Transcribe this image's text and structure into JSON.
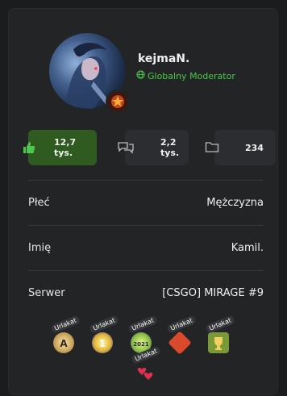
{
  "profile": {
    "username": "kejmaN.",
    "role": "Globalny Moderator",
    "role_color": "#4ac94a"
  },
  "stats": {
    "likes": "12,7 tys.",
    "messages": "2,2 tys.",
    "files": "234"
  },
  "details": [
    {
      "label": "Płeć",
      "value": "Mężczyzna"
    },
    {
      "label": "Imię",
      "value": "Kamil."
    },
    {
      "label": "Serwer",
      "value": "[CSGO] MIRAGE #9"
    }
  ],
  "awards": {
    "tag": "Urlakat",
    "icons": [
      "award-a-icon",
      "award-coin-icon",
      "award-2021-icon",
      "award-card-icon",
      "award-trophy-icon",
      "award-hearts-icon"
    ]
  },
  "colors": {
    "likes_bg": "#2f5a20",
    "card_bg": "#222426"
  }
}
